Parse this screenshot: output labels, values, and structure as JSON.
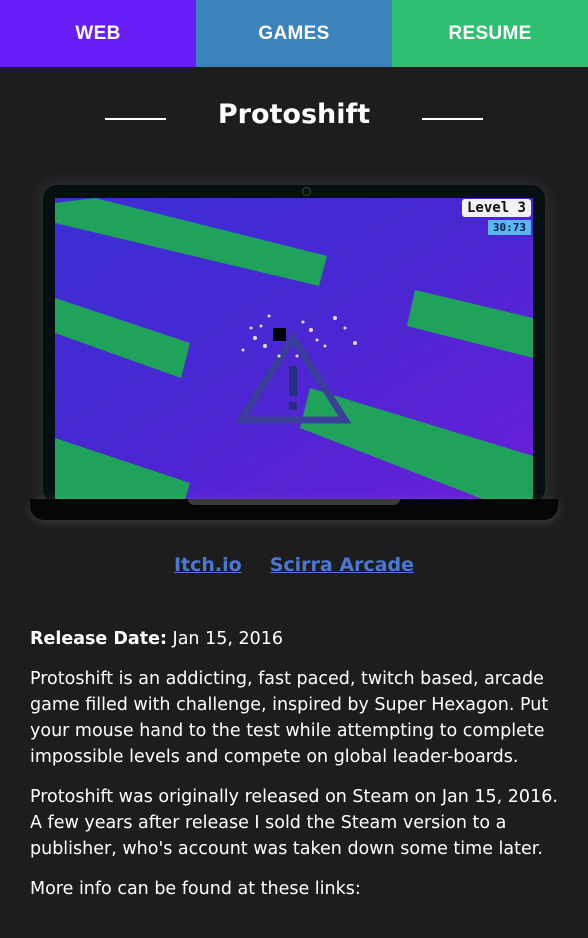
{
  "nav": {
    "tabs": [
      {
        "label": "WEB",
        "color": "#6a1ef7"
      },
      {
        "label": "GAMES",
        "color": "#3a83bd"
      },
      {
        "label": "RESUME",
        "color": "#2fbf71"
      }
    ]
  },
  "page": {
    "title": "Protoshift"
  },
  "game_screenshot": {
    "level": "Level 3",
    "timer": "30:73"
  },
  "links": [
    {
      "label": "Itch.io"
    },
    {
      "label": "Scirra Arcade"
    }
  ],
  "details": {
    "release_label": "Release Date:",
    "release_value": "Jan 15, 2016",
    "paragraphs": [
      "Protoshift is an addicting, fast paced, twitch based, arcade game filled with challenge, inspired by Super Hexagon. Put your mouse hand to the test while attempting to complete impossible levels and compete on global leader-boards.",
      "Protoshift was originally released on Steam on Jan 15, 2016. A few years after release I sold the Steam version to a publisher, who's account was taken down some time later.",
      "More info can be found at these links:"
    ]
  },
  "colors": {
    "background": "#1d1d1d",
    "link": "#4a78d6",
    "game_green": "#1fa35a",
    "game_purple": "#5a22d6"
  }
}
